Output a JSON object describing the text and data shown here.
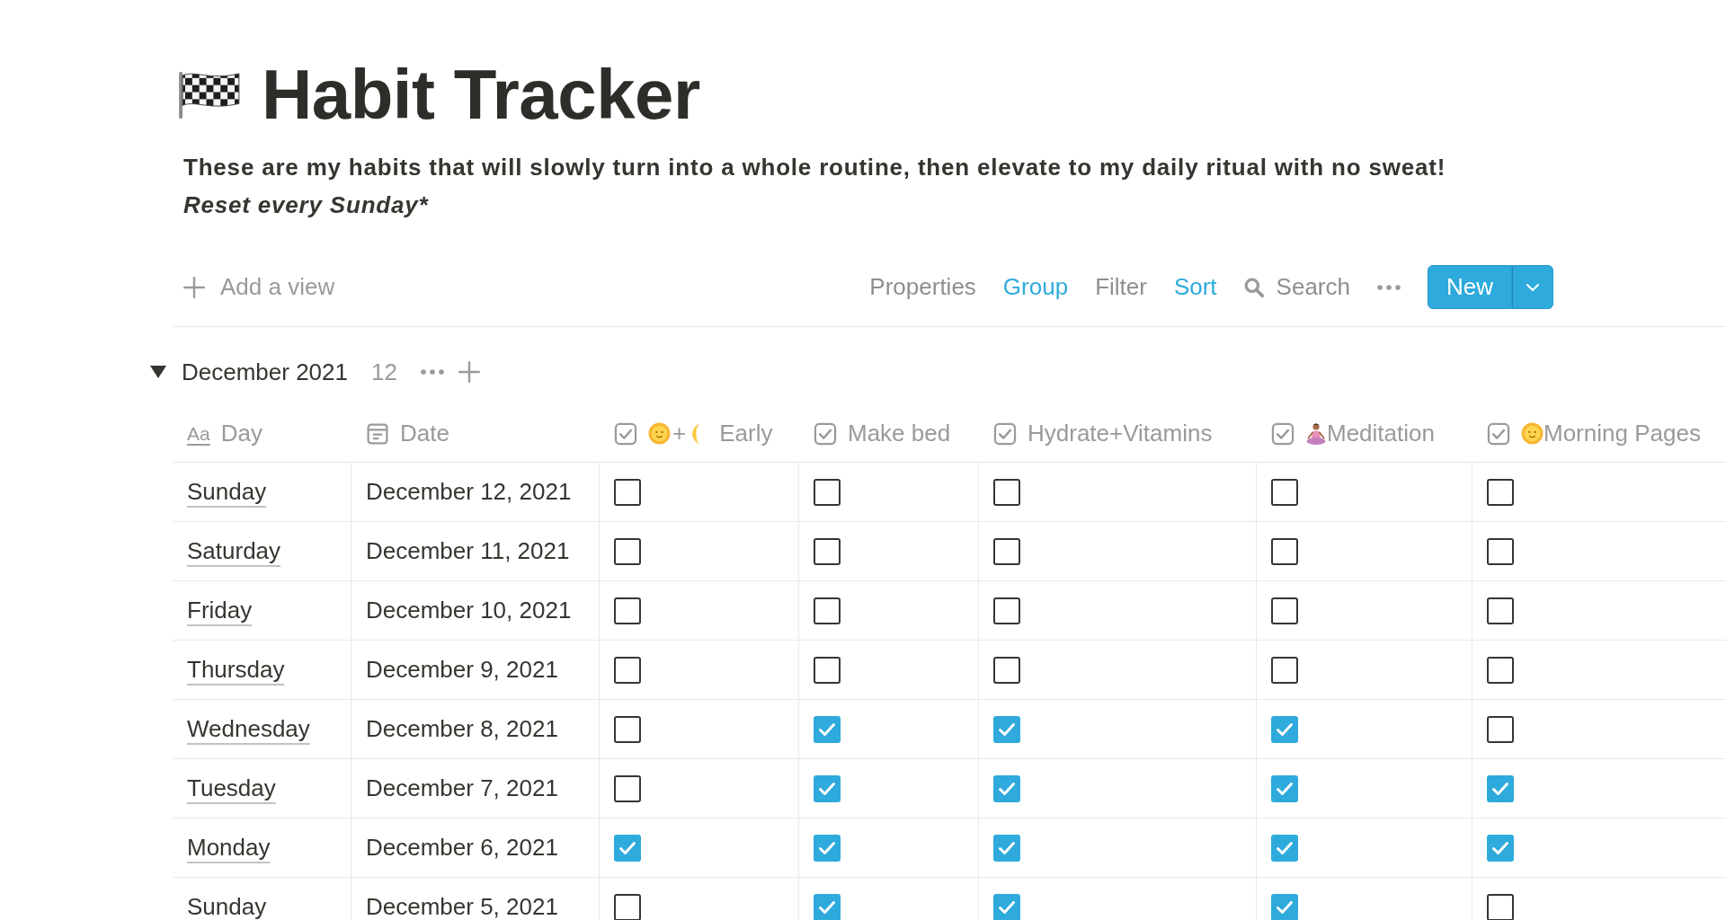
{
  "page": {
    "title": "Habit Tracker",
    "description": "These are my habits that will slowly turn into a whole routine, then elevate to my daily ritual with no sweat!",
    "note": "Reset every Sunday*"
  },
  "toolbar": {
    "add_view": "Add a view",
    "options": [
      {
        "label": "Properties",
        "active": false
      },
      {
        "label": "Group",
        "active": true
      },
      {
        "label": "Filter",
        "active": false
      },
      {
        "label": "Sort",
        "active": true
      }
    ],
    "search": "Search",
    "new_button": "New"
  },
  "group": {
    "title": "December 2021",
    "count": "12",
    "expanded": true
  },
  "table": {
    "columns": [
      {
        "kind": "title",
        "label": "Day",
        "type_glyph": "Aa"
      },
      {
        "kind": "date",
        "label": "Date"
      },
      {
        "kind": "checkbox",
        "label": "Early",
        "joiner": "+"
      },
      {
        "kind": "checkbox",
        "label": "Make bed"
      },
      {
        "kind": "checkbox",
        "label": "Hydrate+Vitamins"
      },
      {
        "kind": "checkbox",
        "label": "Meditation"
      },
      {
        "kind": "checkbox",
        "label": "Morning Pages"
      }
    ],
    "rows": [
      {
        "day": "Sunday",
        "date": "December 12, 2021",
        "checks": [
          {
            "checked": false
          },
          {
            "checked": false
          },
          {
            "checked": false
          },
          {
            "checked": false
          },
          {
            "checked": false
          }
        ]
      },
      {
        "day": "Saturday",
        "date": "December 11, 2021",
        "checks": [
          {
            "checked": false
          },
          {
            "checked": false
          },
          {
            "checked": false
          },
          {
            "checked": false
          },
          {
            "checked": false
          }
        ]
      },
      {
        "day": "Friday",
        "date": "December 10, 2021",
        "checks": [
          {
            "checked": false
          },
          {
            "checked": false
          },
          {
            "checked": false
          },
          {
            "checked": false
          },
          {
            "checked": false
          }
        ]
      },
      {
        "day": "Thursday",
        "date": "December 9, 2021",
        "checks": [
          {
            "checked": false
          },
          {
            "checked": false
          },
          {
            "checked": false
          },
          {
            "checked": false
          },
          {
            "checked": false
          }
        ]
      },
      {
        "day": "Wednesday",
        "date": "December 8, 2021",
        "checks": [
          {
            "checked": false
          },
          {
            "checked": true
          },
          {
            "checked": true
          },
          {
            "checked": true
          },
          {
            "checked": false
          }
        ]
      },
      {
        "day": "Tuesday",
        "date": "December 7, 2021",
        "checks": [
          {
            "checked": false
          },
          {
            "checked": true
          },
          {
            "checked": true
          },
          {
            "checked": true
          },
          {
            "checked": true
          }
        ]
      },
      {
        "day": "Monday",
        "date": "December 6, 2021",
        "checks": [
          {
            "checked": true
          },
          {
            "checked": true
          },
          {
            "checked": true
          },
          {
            "checked": true
          },
          {
            "checked": true
          }
        ]
      },
      {
        "day": "Sunday",
        "date": "December 5, 2021",
        "checks": [
          {
            "checked": false
          },
          {
            "checked": true
          },
          {
            "checked": true
          },
          {
            "checked": true
          },
          {
            "checked": false
          }
        ]
      }
    ]
  }
}
